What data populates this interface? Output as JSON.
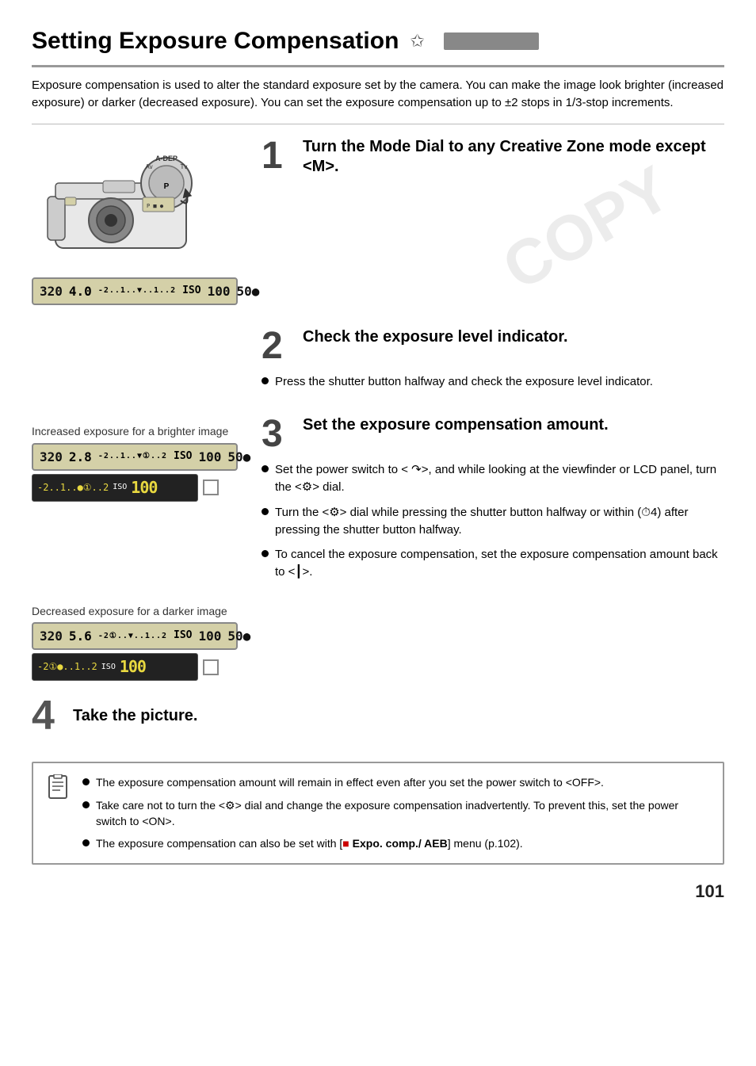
{
  "page": {
    "title": "Setting Exposure Compensation",
    "title_star": "✩",
    "intro": "Exposure compensation is used to alter the standard exposure set by the camera. You can make the image look brighter (increased exposure) or darker (decreased exposure). You can set the exposure compensation up to ±2 stops in 1/3-stop increments.",
    "step1": {
      "number": "1",
      "title": "Turn the Mode Dial to any Creative Zone mode except <M>."
    },
    "step2": {
      "number": "2",
      "title": "Check the exposure level indicator.",
      "bullet1": "Press the shutter button halfway and check the exposure level indicator."
    },
    "step3": {
      "number": "3",
      "title": "Set the exposure compensation amount.",
      "bullet1": "Set the power switch to < ↷>, and while looking at the viewfinder or LCD panel, turn the <⚙> dial.",
      "bullet2": "Turn the <⚙> dial while pressing the shutter button halfway or within (⏱4) after pressing the shutter button halfway.",
      "bullet3": "To cancel the exposure compensation, set the exposure compensation amount back to <┃>."
    },
    "step4": {
      "number": "4",
      "title": "Take the picture."
    },
    "increased_label": "Increased exposure for a brighter image",
    "decreased_label": "Decreased exposure for a darker image",
    "lcd_main": "320  4.0 -2..1..▼..1..2 ISO  100  50●",
    "lcd_increased_top": "320  2.8 -2..1..▼(1)..2 ISO  100  50●",
    "led_increased": "-2..1..●(1)..2 ISO 100",
    "lcd_decreased_top": "320  5.6 -2(1)..▼..1..2 ISO  100  50●",
    "led_decreased": "-2(1)●..1..2 ISO 100",
    "notes": {
      "note1": "The exposure compensation amount will remain in effect even after you set the power switch to <OFF>.",
      "note2": "Take care not to turn the <⚙> dial and change the exposure compensation inadvertently. To prevent this, set the power switch to <ON>.",
      "note3": "The exposure compensation can also be set with [🔴 Expo. comp./ AEB] menu (p.102)."
    },
    "page_number": "101"
  }
}
